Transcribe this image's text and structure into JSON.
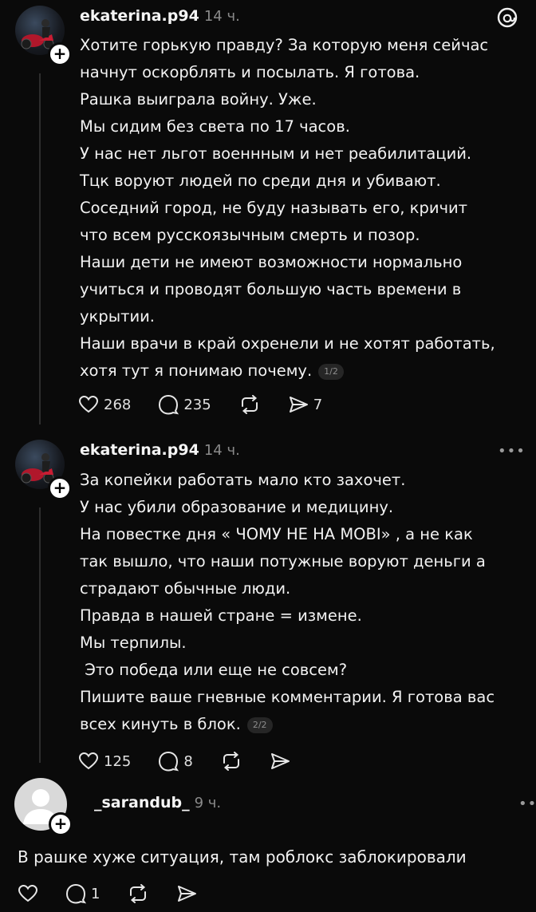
{
  "posts": [
    {
      "username": "ekaterina.p94",
      "time": "14 ч.",
      "lines": [
        "Хотите горькую правду? За которую меня сейчас",
        "начнут оскорблять и посылать. Я готова.",
        "Рашка выиграла войну. Уже.",
        "Мы сидим без света по 17 часов.",
        "У нас нет льгот военнным и нет реабилитаций.",
        "Тцк воруют людей по среди дня и убивают.",
        "Соседний город, не буду называть его, кричит",
        "что всем русскоязычным смерть и позор.",
        "Наши дети не имеют возможности нормально",
        "учиться и проводят большую часть времени в",
        "укрытии.",
        "Наши врачи в край охренели и не хотят работать,",
        "хотя тут я понимаю почему."
      ],
      "pager": "1/2",
      "likes": "268",
      "comments": "235",
      "shares": "7"
    },
    {
      "username": "ekaterina.p94",
      "time": "14 ч.",
      "lines": [
        "За копейки работать мало кто захочет.",
        "У нас убили образование и медицину.",
        "На повестке дня « ЧОМУ НЕ НА МОВІ» , а не как",
        "так вышло, что наши потужные воруют деньги а",
        "страдают обычные люди.",
        "Правда в нашей стране = измене.",
        "Мы терпилы.",
        " Это победа или еще не совсем?",
        "Пишите ваше гневные комментарии. Я готова вас",
        "всех кинуть в блок."
      ],
      "pager": "2/2",
      "likes": "125",
      "comments": "8",
      "more": "•••"
    },
    {
      "username": "_sarandub_",
      "time": "9 ч.",
      "text": "В рашке хуже ситуация, там роблокс заблокировали",
      "comments": "1",
      "more": "••"
    }
  ],
  "icons": {
    "threads": "threads-logo-icon",
    "like": "heart-icon",
    "comment": "comment-bubble-icon",
    "repost": "repost-icon",
    "share": "send-icon"
  }
}
